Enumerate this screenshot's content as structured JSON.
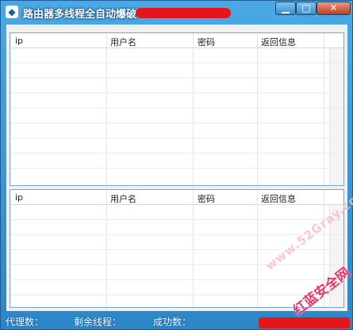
{
  "window": {
    "title": "路由器多线程全自动爆破",
    "icon": "app-logo-icon",
    "controls": {
      "minimize": "▁",
      "maximize": "□",
      "close": "✕"
    }
  },
  "list_top": {
    "columns": [
      "ip",
      "用户名",
      "密码",
      "返回信息"
    ],
    "rows": []
  },
  "list_bottom": {
    "columns": [
      "ip",
      "用户名",
      "密码",
      "返回信息"
    ],
    "rows": []
  },
  "status": {
    "proxy_label": "代理数：",
    "threads_label": "剩余线程：",
    "success_label": "成功数："
  },
  "watermark": {
    "text_en": "www.52Gray.com",
    "text_cn": "红蓝安全网"
  },
  "colors": {
    "title_gradient_top": "#4aa8e4",
    "title_gradient_bottom": "#2c86c8",
    "redaction": "#e4161c",
    "panel_border": "#74a8d4"
  }
}
